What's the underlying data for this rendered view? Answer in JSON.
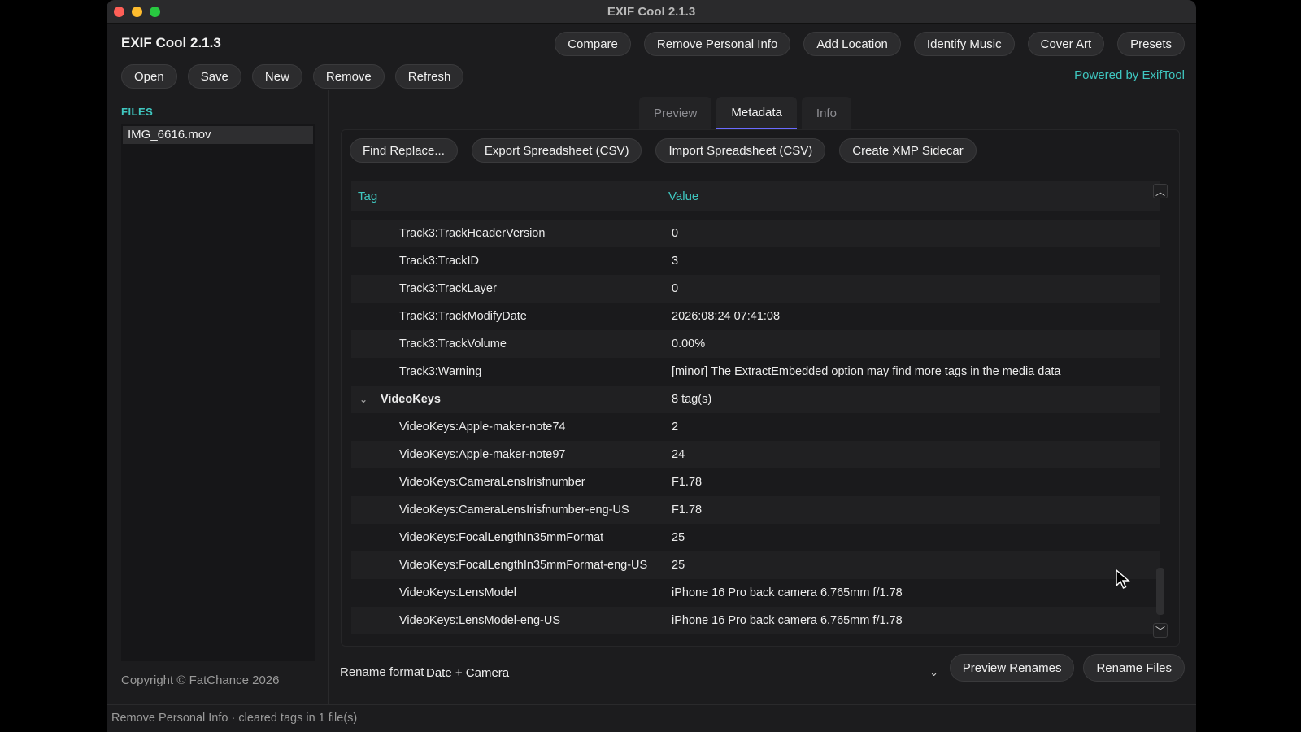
{
  "window": {
    "title": "EXIF Cool 2.1.3"
  },
  "app": {
    "name": "EXIF Cool  2.1.3",
    "powered_by": "Powered by ExifTool"
  },
  "top_actions": [
    {
      "label": "Compare"
    },
    {
      "label": "Remove Personal Info"
    },
    {
      "label": "Add Location"
    },
    {
      "label": "Identify Music"
    },
    {
      "label": "Cover Art"
    },
    {
      "label": "Presets"
    }
  ],
  "file_actions": [
    {
      "label": "Open"
    },
    {
      "label": "Save"
    },
    {
      "label": "New"
    },
    {
      "label": "Remove"
    },
    {
      "label": "Refresh"
    }
  ],
  "sidebar": {
    "files_label": "FILES",
    "files": [
      "IMG_6616.mov"
    ],
    "copyright": "Copyright © FatChance 2026"
  },
  "tabs": [
    {
      "label": "Preview",
      "active": false
    },
    {
      "label": "Metadata",
      "active": true
    },
    {
      "label": "Info",
      "active": false
    }
  ],
  "metadata_toolbar": [
    {
      "label": "Find  Replace..."
    },
    {
      "label": "Export Spreadsheet (CSV)"
    },
    {
      "label": "Import Spreadsheet (CSV)"
    },
    {
      "label": "Create XMP Sidecar"
    }
  ],
  "table": {
    "headers": {
      "tag": "Tag",
      "value": "Value"
    },
    "rows": [
      {
        "tag": "Track3:TrackHeaderVersion",
        "value": "0"
      },
      {
        "tag": "Track3:TrackID",
        "value": "3"
      },
      {
        "tag": "Track3:TrackLayer",
        "value": "0"
      },
      {
        "tag": "Track3:TrackModifyDate",
        "value": "2026:08:24 07:41:08"
      },
      {
        "tag": "Track3:TrackVolume",
        "value": "0.00%"
      },
      {
        "tag": "Track3:Warning",
        "value": "[minor] The ExtractEmbedded option may find more tags in the media data"
      },
      {
        "tag": "VideoKeys",
        "value": "8 tag(s)",
        "group": true
      },
      {
        "tag": "VideoKeys:Apple-maker-note74",
        "value": "2"
      },
      {
        "tag": "VideoKeys:Apple-maker-note97",
        "value": "24"
      },
      {
        "tag": "VideoKeys:CameraLensIrisfnumber",
        "value": "F1.78"
      },
      {
        "tag": "VideoKeys:CameraLensIrisfnumber-eng-US",
        "value": "F1.78"
      },
      {
        "tag": "VideoKeys:FocalLengthIn35mmFormat",
        "value": "25"
      },
      {
        "tag": "VideoKeys:FocalLengthIn35mmFormat-eng-US",
        "value": "25"
      },
      {
        "tag": "VideoKeys:LensModel",
        "value": "iPhone 16 Pro back camera 6.765mm f/1.78"
      },
      {
        "tag": "VideoKeys:LensModel-eng-US",
        "value": "iPhone 16 Pro back camera 6.765mm f/1.78"
      }
    ]
  },
  "rename": {
    "label": "Rename format",
    "selected": "Date + Camera",
    "preview_label": "Preview Renames",
    "rename_label": "Rename Files"
  },
  "status": {
    "text": "Remove Personal Info · cleared tags in 1 file(s)"
  },
  "colors": {
    "accent": "#3fc7c0",
    "tab_underline": "#6b6bff"
  }
}
